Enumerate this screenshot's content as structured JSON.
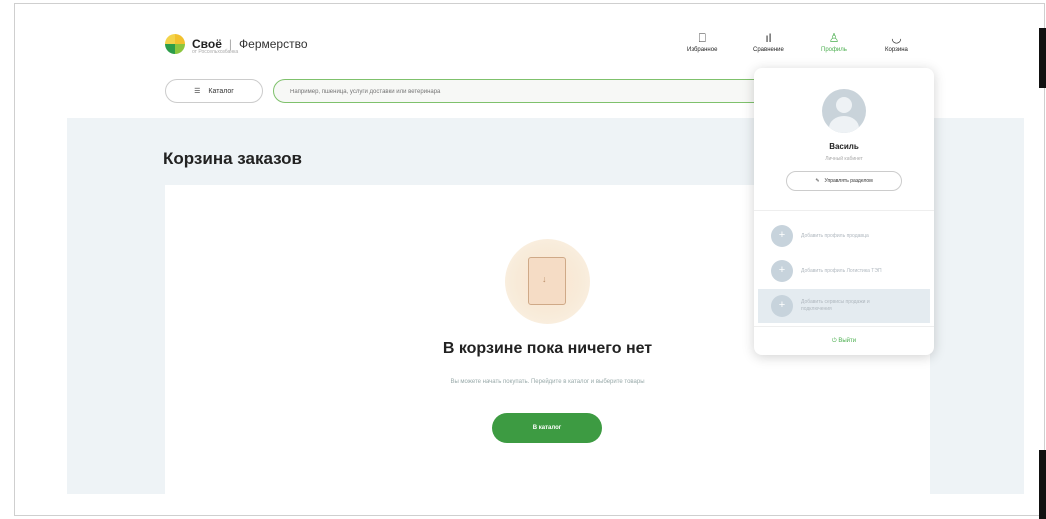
{
  "header": {
    "logo_name": "Своё",
    "logo_separator": "|",
    "logo_sub": "Фермерство",
    "logo_tag": "от Россельхозбанка",
    "nav": [
      {
        "label": "Избранное",
        "icon": "bookmark-icon"
      },
      {
        "label": "Сравнение",
        "icon": "chart-icon"
      },
      {
        "label": "Профиль",
        "icon": "user-icon",
        "active": true
      },
      {
        "label": "Корзина",
        "icon": "cart-icon"
      }
    ],
    "catalog_label": "Каталог",
    "search_placeholder": "Например, пшеница, услуги доставки или ветеринара"
  },
  "main": {
    "page_title": "Корзина заказов",
    "empty_title": "В корзине пока ничего нет",
    "empty_subtitle": "Вы можете начать покупать. Перейдите в каталог и выберите товары",
    "catalog_button": "В каталог"
  },
  "profile_menu": {
    "user_name": "Василь",
    "user_role": "Личный кабинет",
    "manage_button": "Управлять разделом",
    "items": [
      {
        "label": "Добавить профиль продавца"
      },
      {
        "label": "Добавить профиль Логистика ТЭП"
      },
      {
        "label": "Добавить сервисы продажи и подключения"
      }
    ],
    "logout": "Выйти"
  },
  "colors": {
    "accent": "#3d9b42",
    "page_bg": "#eef3f6"
  }
}
